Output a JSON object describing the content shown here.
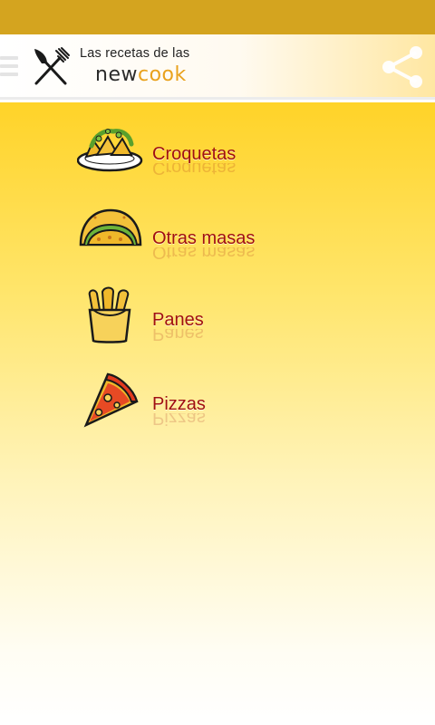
{
  "header": {
    "brand_line1": "Las recetas de las",
    "brand_new": "new",
    "brand_cook": "cook"
  },
  "colors": {
    "status_bar": "#d4a41f",
    "category_text": "#a01010",
    "brand_accent": "#e9a21d",
    "background_top": "#ffd328"
  },
  "icons": {
    "menu": "hamburger-menu-icon",
    "logo": "crossed-fork-knife-icon",
    "share": "share-icon"
  },
  "categories": [
    {
      "label": "Croquetas",
      "icon": "croquettes-plate-icon"
    },
    {
      "label": "Otras masas",
      "icon": "taco-icon"
    },
    {
      "label": "Panes",
      "icon": "bread-basket-icon"
    },
    {
      "label": "Pizzas",
      "icon": "pizza-slice-icon"
    }
  ]
}
